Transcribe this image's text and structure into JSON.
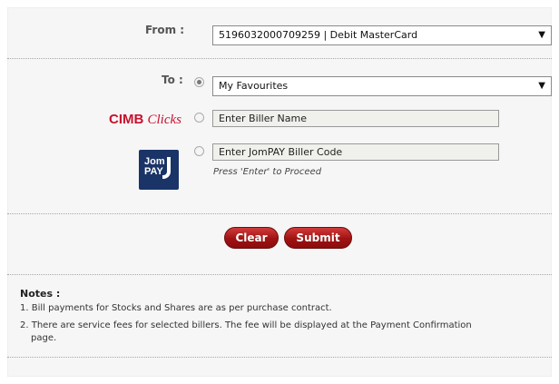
{
  "form": {
    "from_label": "From :",
    "from_value": "5196032000709259 | Debit MasterCard",
    "to_label": "To :",
    "favourites_value": "My Favourites",
    "biller_name_value": "Enter Biller Name",
    "jompay_code_value": "Enter JomPAY Biller Code",
    "hint": "Press 'Enter' to Proceed"
  },
  "logos": {
    "cimb": "CIMB",
    "clicks": "Clicks",
    "jompay_top": "Jom",
    "jompay_bottom": "PAY"
  },
  "buttons": {
    "clear": "Clear",
    "submit": "Submit"
  },
  "notes": {
    "title": "Notes :",
    "items": [
      "1. Bill payments for Stocks and Shares are as per purchase contract.",
      "2. There are service fees for selected billers. The fee will be displayed at the Payment Confirmation",
      "page."
    ]
  },
  "colors": {
    "brand_red": "#c8102e",
    "jompay_blue": "#1a3468"
  },
  "icons": [
    "dropdown-arrow-icon",
    "radio-icon"
  ]
}
